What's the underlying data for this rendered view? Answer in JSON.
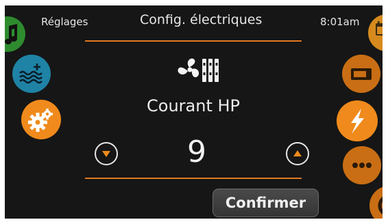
{
  "header": {
    "menu_label": "Réglages",
    "title": "Config. électriques",
    "time": "8:01am"
  },
  "setting": {
    "label": "Courant HP",
    "value": "9"
  },
  "confirm_label": "Confirmer",
  "colors": {
    "accent_orange": "#e2781f",
    "music_green": "#2e8b2e",
    "water_blue": "#1f83a5",
    "background": "#161616"
  },
  "icons": {
    "left": [
      "music-icon",
      "water-level-icon",
      "settings-gears-icon"
    ],
    "right": [
      "calendar-icon",
      "display-icon",
      "electric-bolt-icon",
      "more-icon",
      "power-icon"
    ],
    "main": "fan-heater-icon"
  }
}
